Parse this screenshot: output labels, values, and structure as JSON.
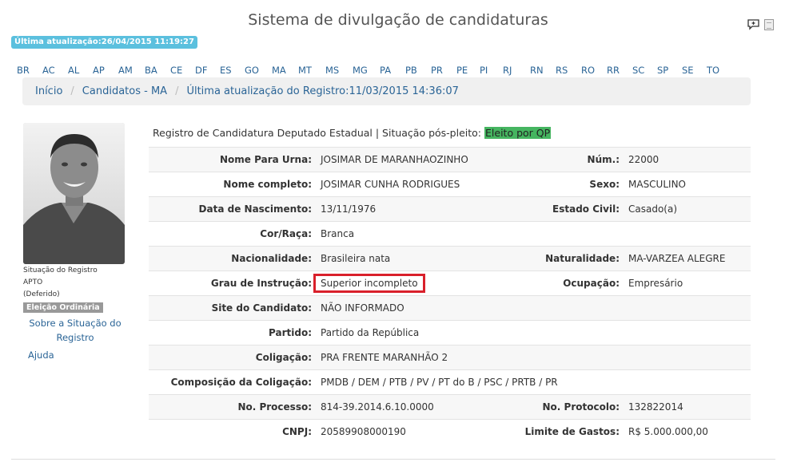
{
  "header": {
    "title": "Sistema de divulgação de candidaturas",
    "update_badge": "Última atualização:26/04/2015 11:19:27"
  },
  "states": [
    "BR",
    "AC",
    "AL",
    "AP",
    "AM",
    "BA",
    "CE",
    "DF",
    "ES",
    "GO",
    "MA",
    "MT",
    "MS",
    "MG",
    "PA",
    "PB",
    "PR",
    "PE",
    "PI",
    "RJ",
    "RN",
    "RS",
    "RO",
    "RR",
    "SC",
    "SP",
    "SE",
    "TO"
  ],
  "breadcrumb": {
    "home": "Início",
    "candidates": "Candidatos - MA",
    "current": "Última atualização do Registro:11/03/2015 14:36:07"
  },
  "sidebar": {
    "status_label": "Situação do Registro",
    "status_value": "APTO",
    "status_detail": "(Deferido)",
    "election_badge": "Eleição Ordinária",
    "about_status_link": "Sobre a Situação do Registro",
    "help_link": "Ajuda"
  },
  "registration": {
    "title": "Registro de Candidatura Deputado Estadual | Situação pós-pleito:",
    "post_election_status": "Eleito por QP"
  },
  "fields": {
    "nome_urna": {
      "label": "Nome Para Urna:",
      "value": "JOSIMAR DE MARANHAOZINHO"
    },
    "num": {
      "label": "Núm.:",
      "value": "22000"
    },
    "nome_completo": {
      "label": "Nome completo:",
      "value": "JOSIMAR CUNHA RODRIGUES"
    },
    "sexo": {
      "label": "Sexo:",
      "value": "MASCULINO"
    },
    "nascimento": {
      "label": "Data de Nascimento:",
      "value": "13/11/1976"
    },
    "estado_civil": {
      "label": "Estado Civil:",
      "value": "Casado(a)"
    },
    "cor_raca": {
      "label": "Cor/Raça:",
      "value": "Branca"
    },
    "nacionalidade": {
      "label": "Nacionalidade:",
      "value": "Brasileira nata"
    },
    "naturalidade": {
      "label": "Naturalidade:",
      "value": "MA-VARZEA ALEGRE"
    },
    "grau_instrucao": {
      "label": "Grau de Instrução:",
      "value": "Superior incompleto"
    },
    "ocupacao": {
      "label": "Ocupação:",
      "value": "Empresário"
    },
    "site": {
      "label": "Site do Candidato:",
      "value": "NÃO INFORMADO"
    },
    "partido": {
      "label": "Partido:",
      "value": "Partido da República"
    },
    "coligacao": {
      "label": "Coligação:",
      "value": "PRA FRENTE MARANHÃO 2"
    },
    "composicao": {
      "label": "Composição da Coligação:",
      "value": "PMDB / DEM / PTB / PV / PT do B / PSC / PRTB / PR"
    },
    "processo": {
      "label": "No. Processo:",
      "value": "814-39.2014.6.10.0000"
    },
    "protocolo": {
      "label": "No. Protocolo:",
      "value": "132822014"
    },
    "cnpj": {
      "label": "CNPJ:",
      "value": "20589908000190"
    },
    "limite_gastos": {
      "label": "Limite de Gastos:",
      "value": "R$ 5.000.000,00"
    }
  },
  "colors": {
    "link": "#2a6496",
    "badge_blue": "#5bc0de",
    "status_green": "#45b560",
    "highlight_red": "#d9202b"
  },
  "icons": [
    "comment-icon",
    "document-icon"
  ]
}
